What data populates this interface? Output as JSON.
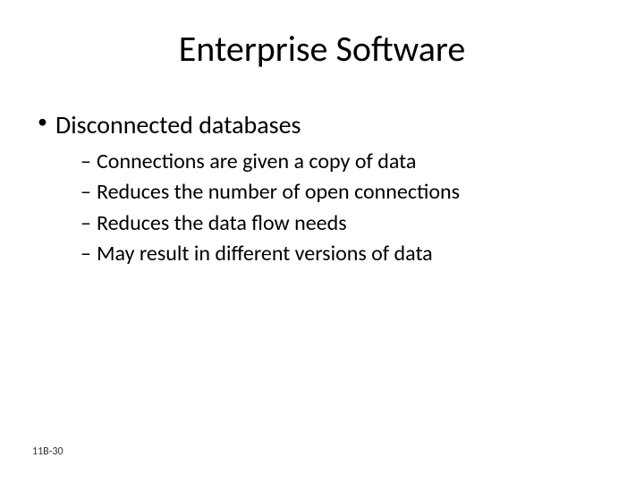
{
  "title": "Enterprise Software",
  "bullet1": "Disconnected databases",
  "sub1": "Connections are given a copy of data",
  "sub2": "Reduces the number of open connections",
  "sub3": "Reduces the data flow needs",
  "sub4": "May result in different versions of data",
  "slide_number": "11B-30"
}
